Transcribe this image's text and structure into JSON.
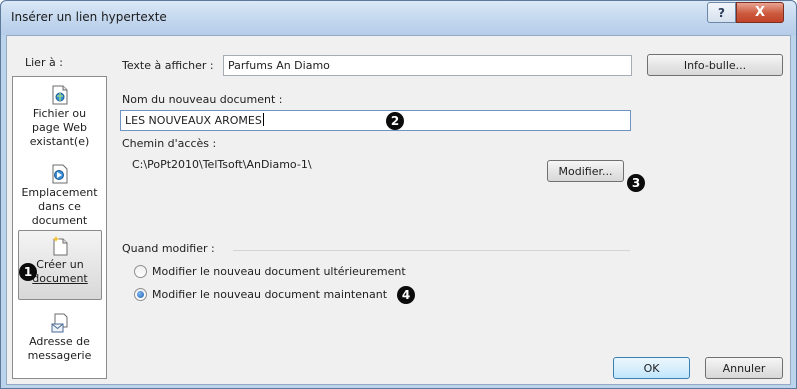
{
  "window": {
    "title": "Insérer un lien hypertexte",
    "help_label": "?",
    "close_label": "X"
  },
  "nav": {
    "header": "Lier à :",
    "items": [
      {
        "line1": "Fichier ou",
        "line2": "page Web",
        "line3": "existant(e)",
        "icon": "web-page-icon"
      },
      {
        "line1": "Emplacement",
        "line2": "dans ce",
        "line3": "document",
        "icon": "place-in-document-icon"
      },
      {
        "line1": "Créer un",
        "line2": "document",
        "icon": "new-document-icon",
        "selected": true
      },
      {
        "line1": "Adresse de",
        "line2": "messagerie",
        "icon": "email-address-icon"
      }
    ]
  },
  "text_to_display": {
    "label": "Texte à afficher :",
    "value": "Parfums An Diamo"
  },
  "screentip_button": "Info-bulle...",
  "new_document_name": {
    "label": "Nom du nouveau document :",
    "value": "LES NOUVEAUX AROMES"
  },
  "path": {
    "label": "Chemin d'accès :",
    "value": "C:\\PoPt2010\\TelTsoft\\AnDiamo-1\\"
  },
  "modify_button": "Modifier...",
  "when_to_edit": {
    "label": "Quand modifier :",
    "options": [
      {
        "label": "Modifier le nouveau document ultérieurement",
        "selected": false
      },
      {
        "label": "Modifier le nouveau document maintenant",
        "selected": true
      }
    ]
  },
  "ok_button": "OK",
  "cancel_button": "Annuler",
  "callouts": [
    "1",
    "2",
    "3",
    "4"
  ]
}
